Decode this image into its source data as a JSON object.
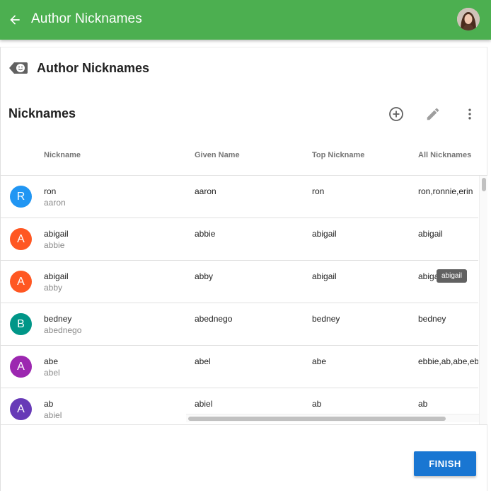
{
  "appbar": {
    "title": "Author Nicknames",
    "color": "#4caf50"
  },
  "card": {
    "title": "Author Nicknames",
    "icon": "tag-face-icon"
  },
  "section": {
    "title": "Nicknames",
    "tools": [
      "add-circle-icon",
      "edit-icon",
      "more-vert-icon"
    ]
  },
  "table": {
    "headers": {
      "nickname": "Nickname",
      "given": "Given Name",
      "top": "Top Nickname",
      "all": "All Nicknames"
    },
    "rows": [
      {
        "initial": "R",
        "color": "#2196f3",
        "nickname": "ron",
        "sub": "aaron",
        "given": "aaron",
        "top": "ron",
        "all": "ron,ronnie,erin"
      },
      {
        "initial": "A",
        "color": "#ff5722",
        "nickname": "abigail",
        "sub": "abbie",
        "given": "abbie",
        "top": "abigail",
        "all": "abigail"
      },
      {
        "initial": "A",
        "color": "#ff5722",
        "nickname": "abigail",
        "sub": "abby",
        "given": "abby",
        "top": "abigail",
        "all": "abigail"
      },
      {
        "initial": "B",
        "color": "#009688",
        "nickname": "bedney",
        "sub": "abednego",
        "given": "abednego",
        "top": "bedney",
        "all": "bedney"
      },
      {
        "initial": "A",
        "color": "#9c27b0",
        "nickname": "abe",
        "sub": "abel",
        "given": "abel",
        "top": "abe",
        "all": "ebbie,ab,abe,eb"
      },
      {
        "initial": "A",
        "color": "#673ab7",
        "nickname": "ab",
        "sub": "abiel",
        "given": "abiel",
        "top": "ab",
        "all": "ab"
      }
    ],
    "tooltip": "abigail"
  },
  "footer": {
    "finish_label": "FINISH",
    "finish_color": "#1976d2"
  }
}
